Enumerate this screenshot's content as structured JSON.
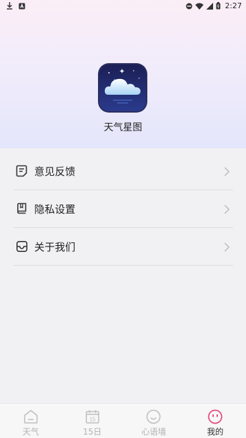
{
  "status_bar": {
    "time": "2:27"
  },
  "app": {
    "name": "天气星图"
  },
  "menu": [
    {
      "label": "意见反馈",
      "icon": "feedback-icon"
    },
    {
      "label": "隐私设置",
      "icon": "book-icon"
    },
    {
      "label": "关于我们",
      "icon": "inbox-icon"
    }
  ],
  "tabs": [
    {
      "label": "天气",
      "icon": "home-icon",
      "active": false
    },
    {
      "label": "15日",
      "icon": "calendar-icon",
      "calendar_text": "15",
      "active": false
    },
    {
      "label": "心语墙",
      "icon": "smile-icon",
      "active": false
    },
    {
      "label": "我的",
      "icon": "face-icon",
      "active": true
    }
  ],
  "colors": {
    "accent": "#e6447a",
    "inactive": "#b2b2b2",
    "background": "#f1f1f3"
  }
}
